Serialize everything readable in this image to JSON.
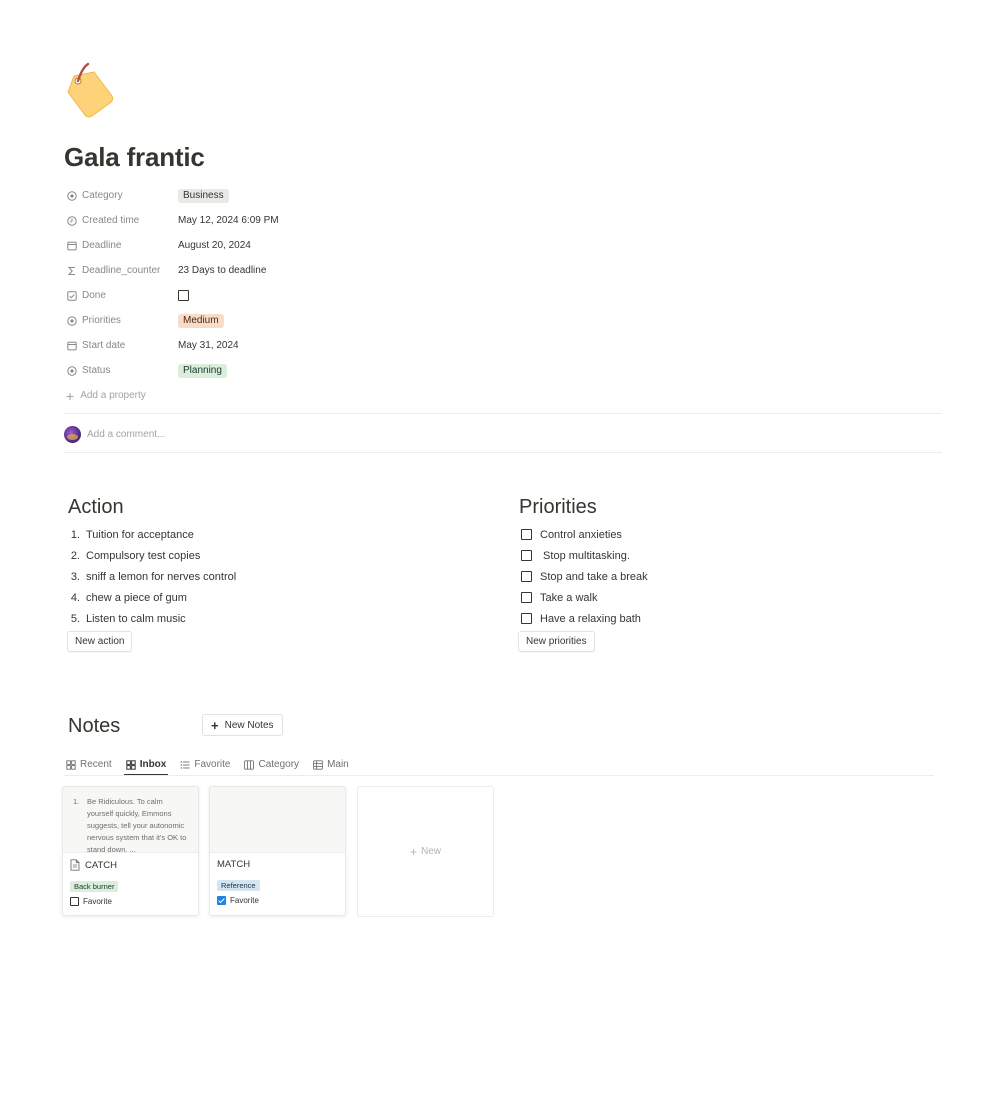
{
  "page": {
    "icon": "tag-emoji-icon",
    "title": "Gala frantic"
  },
  "properties": [
    {
      "name": "Category",
      "icon": "select-icon",
      "value": "Business",
      "type": "tag",
      "color": "#e9e9e7"
    },
    {
      "name": "Created time",
      "icon": "clock-icon",
      "value": "May 12, 2024 6:09 PM",
      "type": "text"
    },
    {
      "name": "Deadline",
      "icon": "calendar-icon",
      "value": "August 20, 2024",
      "type": "text"
    },
    {
      "name": "Deadline_counter",
      "icon": "sigma-icon",
      "value": "23 Days to deadline",
      "type": "text"
    },
    {
      "name": "Done",
      "icon": "checkbox-icon",
      "value": "",
      "type": "checkbox"
    },
    {
      "name": "Priorities",
      "icon": "select-icon",
      "value": "Medium",
      "type": "tag",
      "color": "#f9dcc8"
    },
    {
      "name": "Start date",
      "icon": "calendar-icon",
      "value": "May 31, 2024",
      "type": "text"
    },
    {
      "name": "Status",
      "icon": "select-icon",
      "value": "Planning",
      "type": "tag",
      "color": "#dbeddb"
    }
  ],
  "add_property": "Add a property",
  "comment": {
    "placeholder": "Add a comment..."
  },
  "action": {
    "title": "Action",
    "items": [
      "Tuition for acceptance",
      "Compulsory test copies",
      "sniff a lemon for nerves control",
      "chew a piece of gum",
      "Listen to calm music"
    ],
    "button": "New action"
  },
  "priorities": {
    "title": "Priorities",
    "items": [
      "Control anxieties",
      " Stop multitasking.",
      "Stop and take a break",
      "Take a walk",
      "Have a relaxing bath"
    ],
    "button": "New priorities"
  },
  "notes": {
    "title": "Notes",
    "new_button": "New Notes",
    "tabs": [
      {
        "label": "Recent",
        "icon": "gallery-icon"
      },
      {
        "label": "Inbox",
        "icon": "gallery-icon",
        "active": true
      },
      {
        "label": "Favorite",
        "icon": "list-icon"
      },
      {
        "label": "Category",
        "icon": "board-icon"
      },
      {
        "label": "Main",
        "icon": "table-icon"
      }
    ],
    "cards": [
      {
        "preview": "Be Ridiculous. To calm yourself quickly, Emmons suggests, tell your autonomic nervous system that it's OK to stand down. ...",
        "preview_number": "1.",
        "title": "CATCH",
        "tag": "Back burner",
        "tag_color": "#dbeddb",
        "tag_text_color": "#1c3829",
        "fav_label": "Favorite",
        "favorite": false
      },
      {
        "preview": "",
        "preview_number": "",
        "title": "MATCH",
        "tag": "Reference",
        "tag_color": "#d3e5ef",
        "tag_text_color": "#183347",
        "fav_label": "Favorite",
        "favorite": true
      }
    ],
    "new_card_label": "New"
  }
}
